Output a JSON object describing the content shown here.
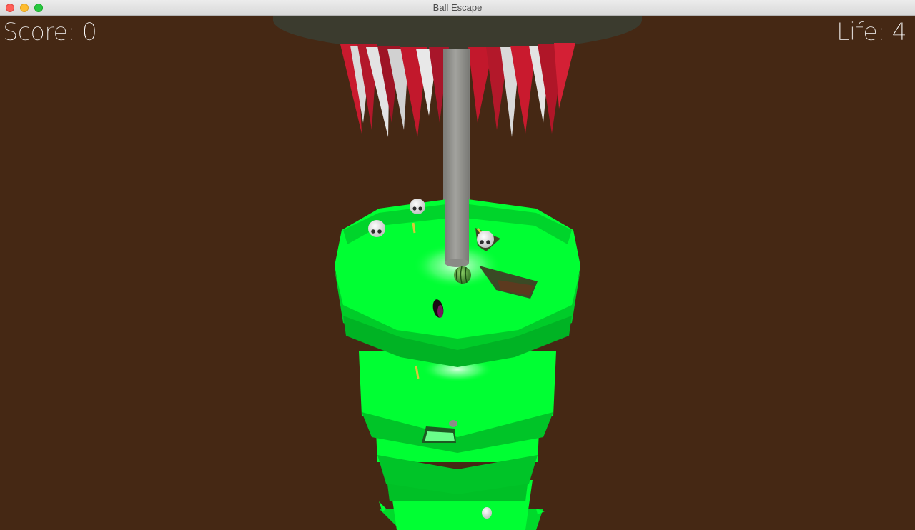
{
  "window": {
    "title": "Ball Escape"
  },
  "hud": {
    "score": "Score: 0",
    "life": "Life: 4"
  },
  "scene": {
    "background": "#452814",
    "platform_color": "#00ff33",
    "ceiling_color": "#3b3b2e",
    "spike_color": "#c0152b",
    "pole_color": "#8c8c88",
    "player_ball": "watermelon-ball",
    "enemy": "skull",
    "pickup": "gold-coin",
    "hazard": "dark-hole"
  }
}
